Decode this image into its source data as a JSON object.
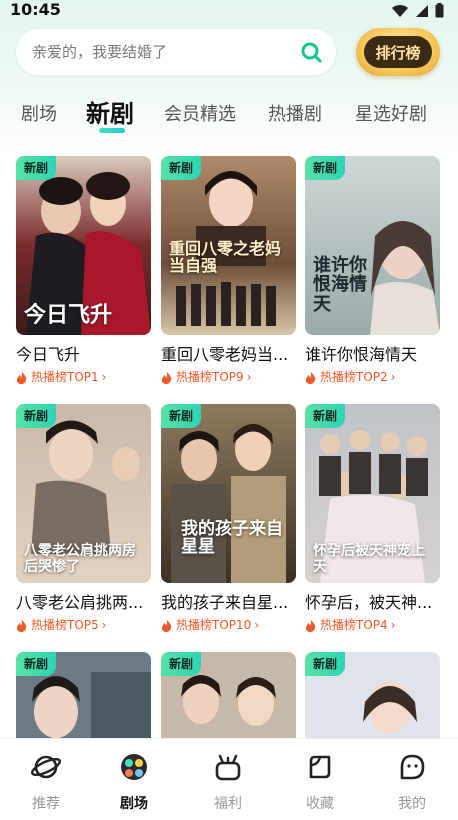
{
  "status_bar": {
    "time": "10:45"
  },
  "search": {
    "placeholder": "亲爱的，我要结婚了"
  },
  "rank_button": {
    "label": "排行榜"
  },
  "tabs": [
    {
      "label": "剧场",
      "active": false
    },
    {
      "label": "新剧",
      "active": true
    },
    {
      "label": "会员精选",
      "active": false
    },
    {
      "label": "热播剧",
      "active": false
    },
    {
      "label": "星选好剧",
      "active": false
    }
  ],
  "cards": [
    {
      "badge": "新剧",
      "title": "今日飞升",
      "rank": "热播榜TOP1",
      "poster_text": "今日飞升"
    },
    {
      "badge": "新剧",
      "title": "重回八零老妈当...",
      "rank": "热播榜TOP9",
      "poster_text": "重回八零之老妈当自强"
    },
    {
      "badge": "新剧",
      "title": "谁许你恨海情天",
      "rank": "热播榜TOP2",
      "poster_text": "谁许你恨海情天"
    },
    {
      "badge": "新剧",
      "title": "八零老公肩挑两...",
      "rank": "热播榜TOP5",
      "poster_text": "八零老公肩挑两房后哭惨了"
    },
    {
      "badge": "新剧",
      "title": "我的孩子来自星...",
      "rank": "热播榜TOP10",
      "poster_text": "我的孩子来自星星"
    },
    {
      "badge": "新剧",
      "title": "怀孕后，被天神...",
      "rank": "热播榜TOP4",
      "poster_text": "怀孕后被天神宠上天"
    },
    {
      "badge": "新剧",
      "title": "",
      "rank": "",
      "poster_text": ""
    },
    {
      "badge": "新剧",
      "title": "",
      "rank": "",
      "poster_text": ""
    },
    {
      "badge": "新剧",
      "title": "",
      "rank": "",
      "poster_text": ""
    }
  ],
  "bottom_nav": [
    {
      "label": "推荐",
      "icon": "planet-icon",
      "active": false
    },
    {
      "label": "剧场",
      "icon": "theater-icon",
      "active": true
    },
    {
      "label": "福利",
      "icon": "gift-icon",
      "active": false
    },
    {
      "label": "收藏",
      "icon": "bookmark-icon",
      "active": false
    },
    {
      "label": "我的",
      "icon": "profile-icon",
      "active": false
    }
  ],
  "colors": {
    "accent": "#2fd3b4",
    "rank": "#f05a28",
    "badge": "#58e3a5"
  }
}
